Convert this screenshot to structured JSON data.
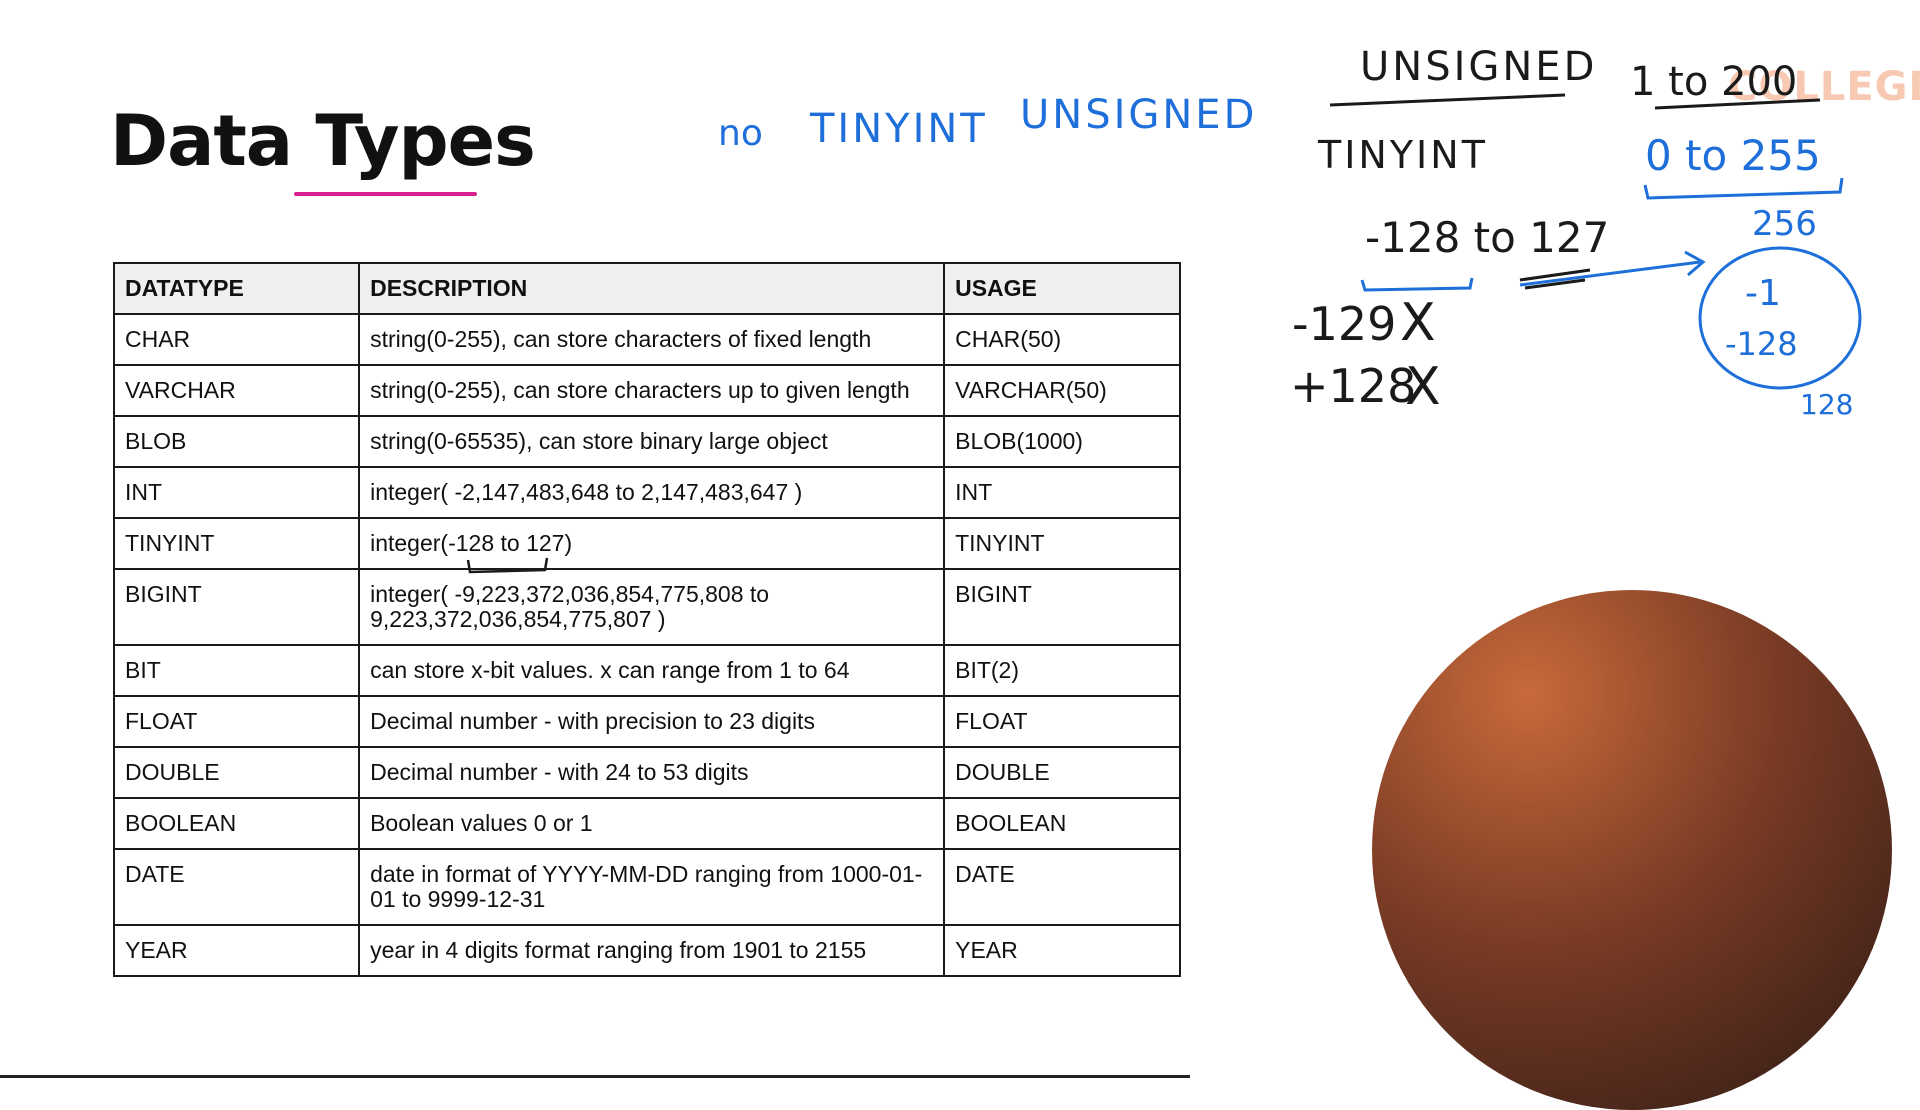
{
  "slide": {
    "title": "Data Types"
  },
  "table": {
    "headers": [
      "DATATYPE",
      "DESCRIPTION",
      "USAGE"
    ],
    "rows": [
      [
        "CHAR",
        "string(0-255), can store characters of fixed length",
        "CHAR(50)"
      ],
      [
        "VARCHAR",
        "string(0-255), can store characters up to given length",
        "VARCHAR(50)"
      ],
      [
        "BLOB",
        "string(0-65535), can store binary large object",
        "BLOB(1000)"
      ],
      [
        "INT",
        "integer( -2,147,483,648 to 2,147,483,647 )",
        "INT"
      ],
      [
        "TINYINT",
        "integer(-128 to 127)",
        "TINYINT"
      ],
      [
        "BIGINT",
        "integer( -9,223,372,036,854,775,808 to 9,223,372,036,854,775,807 )",
        "BIGINT"
      ],
      [
        "BIT",
        "can store x-bit values. x can range from 1 to 64",
        "BIT(2)"
      ],
      [
        "FLOAT",
        "Decimal number - with precision to 23 digits",
        "FLOAT"
      ],
      [
        "DOUBLE",
        "Decimal number - with 24 to 53 digits",
        "DOUBLE"
      ],
      [
        "BOOLEAN",
        "Boolean values 0 or 1",
        "BOOLEAN"
      ],
      [
        "DATE",
        "date in format of YYYY-MM-DD ranging from 1000-01-01 to 9999-12-31",
        "DATE"
      ],
      [
        "YEAR",
        "year in 4 digits format ranging from 1901 to 2155",
        "YEAR"
      ]
    ]
  },
  "annotations": {
    "note_no": "no",
    "note_tinyint": "TINYINT",
    "note_unsigned": "UNSIGNED",
    "unsigned_heading": "UNSIGNED",
    "tinyint_label": "TINYINT",
    "signed_range": "-128 to 127",
    "minus129": "-129",
    "plus128": "+128",
    "cross": "X",
    "range_1_200": "1 to 200",
    "range_0_255": "0 to 255",
    "count_256": "256",
    "circle_line1": "-1",
    "circle_line2": "-128",
    "count_128": "128"
  },
  "watermark": "COLLEGE",
  "colors": {
    "accent_underline": "#d6208f",
    "ink_blue": "#1e6fd9",
    "ink_black": "#1a1a1a"
  }
}
